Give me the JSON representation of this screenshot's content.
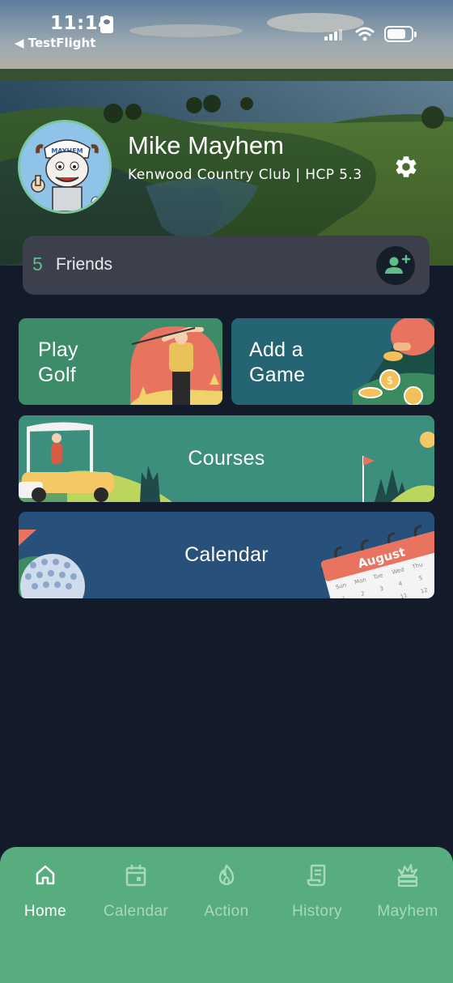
{
  "status_bar": {
    "time": "11:14",
    "back_app": "◀ TestFlight"
  },
  "profile": {
    "name": "Mike Mayhem",
    "club_line": "Kenwood Country Club | HCP 5.3"
  },
  "friends": {
    "count": "5",
    "label": "Friends"
  },
  "tiles": {
    "play": "Play Golf",
    "play_line1": "Play",
    "play_line2": "Golf",
    "add_line1": "Add a",
    "add_line2": "Game",
    "courses": "Courses",
    "calendar": "Calendar",
    "calendar_month": "August"
  },
  "nav": [
    {
      "label": "Home",
      "icon": "home-icon",
      "active": true
    },
    {
      "label": "Calendar",
      "icon": "calendar-icon",
      "active": false
    },
    {
      "label": "Action",
      "icon": "flame-icon",
      "active": false
    },
    {
      "label": "History",
      "icon": "scroll-icon",
      "active": false
    },
    {
      "label": "Mayhem",
      "icon": "explosion-icon",
      "active": false
    }
  ],
  "colors": {
    "background": "#131a29",
    "accent_green": "#57ad7d",
    "friends_count": "#5fbd8a",
    "play_tile": "#3d8c69",
    "addgame_tile": "#256472",
    "courses_tile": "#3d8f7d",
    "calendar_tile": "#27507a"
  }
}
